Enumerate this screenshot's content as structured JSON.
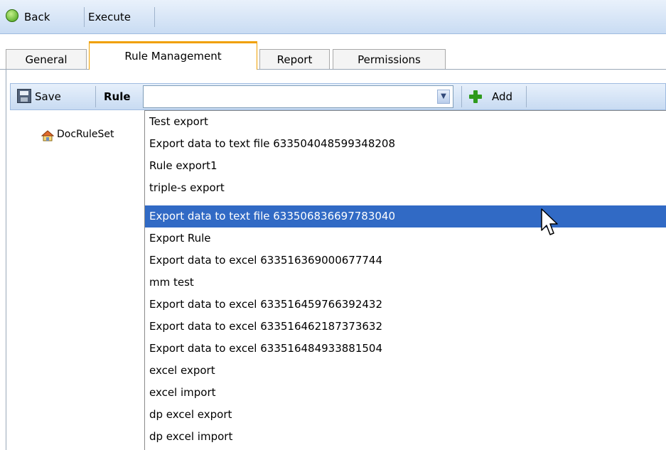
{
  "toolbar": {
    "back_label": "Back",
    "execute_label": "Execute"
  },
  "tabs": [
    {
      "label": "General",
      "active": false
    },
    {
      "label": "Rule Management",
      "active": true
    },
    {
      "label": "Report",
      "active": false
    },
    {
      "label": "Permissions",
      "active": false
    }
  ],
  "rule_toolbar": {
    "save_label": "Save",
    "rule_label": "Rule",
    "rule_value": "",
    "add_label": "Add"
  },
  "tree": {
    "root_label": "DocRuleSet"
  },
  "dropdown": {
    "selected_index": 4,
    "items": [
      "Test export",
      "Export data to text file 633504048599348208",
      "Rule export1",
      "triple-s export",
      "Export data to text file 633506836697783040",
      "Export Rule",
      "Export data to excel 633516369000677744",
      "mm test",
      "Export data to excel 633516459766392432",
      "Export data to excel 633516462187373632",
      "Export data to excel 633516484933881504",
      "excel export",
      "excel import",
      "dp excel export",
      "dp excel import"
    ]
  },
  "colors": {
    "selection": "#316ac5",
    "active_tab_accent": "#f0a000",
    "toolbar_gradient_top": "#e9f1fb",
    "toolbar_gradient_bottom": "#c9dcf3"
  }
}
